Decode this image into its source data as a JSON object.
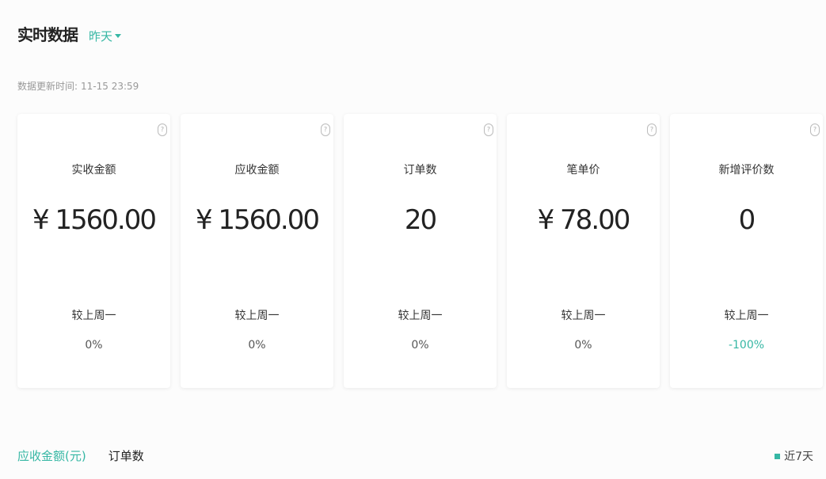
{
  "header": {
    "title": "实时数据",
    "range_label": "昨天"
  },
  "update": {
    "label": "数据更新时间:",
    "value": "11-15 23:59"
  },
  "cards": [
    {
      "label": "实收金额",
      "value": "¥ 1560.00",
      "compare_label": "较上周一",
      "compare_value": "0%"
    },
    {
      "label": "应收金额",
      "value": "¥ 1560.00",
      "compare_label": "较上周一",
      "compare_value": "0%"
    },
    {
      "label": "订单数",
      "value": "20",
      "compare_label": "较上周一",
      "compare_value": "0%"
    },
    {
      "label": "笔单价",
      "value": "¥ 78.00",
      "compare_label": "较上周一",
      "compare_value": "0%"
    },
    {
      "label": "新增评价数",
      "value": "0",
      "compare_label": "较上周一",
      "compare_value": "-100%"
    }
  ],
  "help_icon_glyph": "?",
  "tabs": [
    {
      "label": "应收金额(元)"
    },
    {
      "label": "订单数"
    }
  ],
  "legend": {
    "label": "近7天"
  },
  "colors": {
    "accent": "#36b7a4"
  }
}
